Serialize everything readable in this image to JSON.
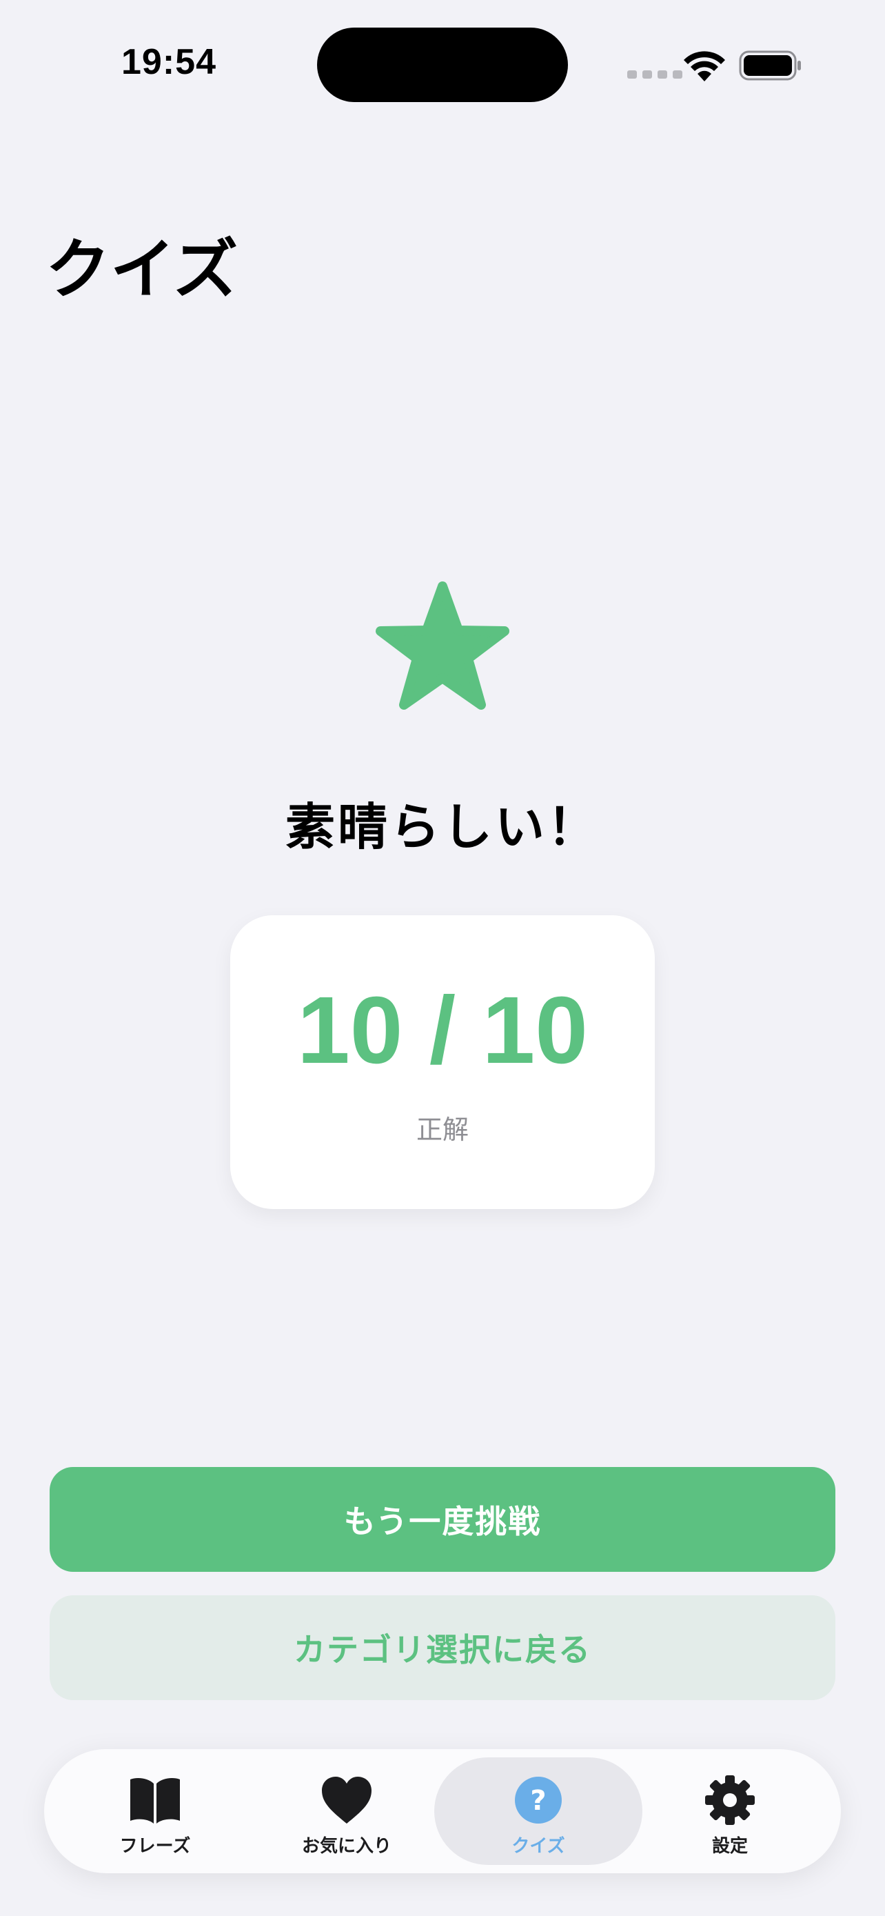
{
  "status_bar": {
    "time": "19:54"
  },
  "header": {
    "title": "クイズ"
  },
  "result": {
    "icon": "star-icon",
    "message": "素晴らしい！",
    "score": "10 / 10",
    "score_label": "正解"
  },
  "actions": {
    "retry_label": "もう一度挑戦",
    "back_label": "カテゴリ選択に戻る"
  },
  "tab_bar": {
    "items": [
      {
        "label": "フレーズ",
        "icon": "book-icon",
        "active": false
      },
      {
        "label": "お気に入り",
        "icon": "heart-icon",
        "active": false
      },
      {
        "label": "クイズ",
        "icon": "question-icon",
        "active": true
      },
      {
        "label": "設定",
        "icon": "gear-icon",
        "active": false
      }
    ]
  },
  "colors": {
    "accent_green": "#5cc181",
    "active_tab_blue": "#6aaee8",
    "background": "#f2f2f7"
  }
}
